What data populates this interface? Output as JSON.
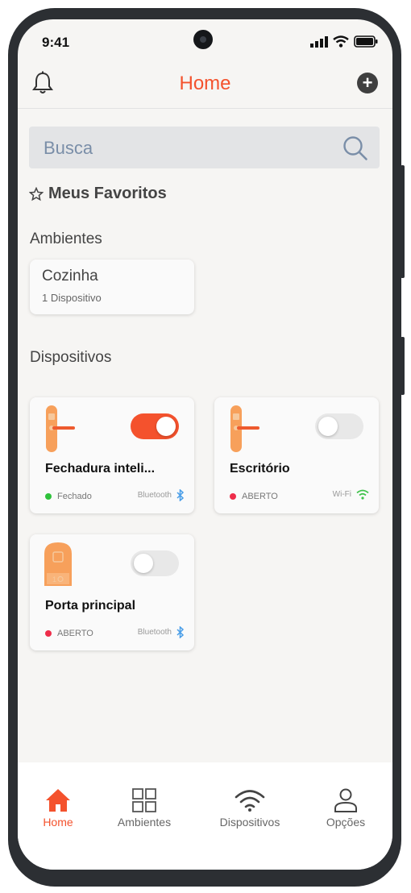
{
  "status_bar": {
    "time": "9:41"
  },
  "header": {
    "title": "Home"
  },
  "search": {
    "placeholder": "Busca"
  },
  "favorites": {
    "label": "Meus Favoritos"
  },
  "rooms": {
    "heading": "Ambientes",
    "items": [
      {
        "name": "Cozinha",
        "count": "1 Dispositivo"
      }
    ]
  },
  "devices": {
    "heading": "Dispositivos",
    "items": [
      {
        "name": "Fechadura inteli...",
        "state": "Fechado",
        "state_color": "#2ec23b",
        "connection": "Bluetooth",
        "toggle_on": true
      },
      {
        "name": "Escritório",
        "state": "ABERTO",
        "state_color": "#ee2d4a",
        "connection": "Wi-Fi",
        "toggle_on": false
      },
      {
        "name": "Porta principal",
        "state": "ABERTO",
        "state_color": "#ee2d4a",
        "connection": "Bluetooth",
        "toggle_on": false
      }
    ]
  },
  "tabbar": {
    "items": [
      {
        "label": "Home",
        "active": true
      },
      {
        "label": "Ambientes",
        "active": false
      },
      {
        "label": "Dispositivos",
        "active": false
      },
      {
        "label": "Opções",
        "active": false
      }
    ]
  },
  "colors": {
    "accent": "#f4522d",
    "device_orange": "#f7a05b"
  }
}
